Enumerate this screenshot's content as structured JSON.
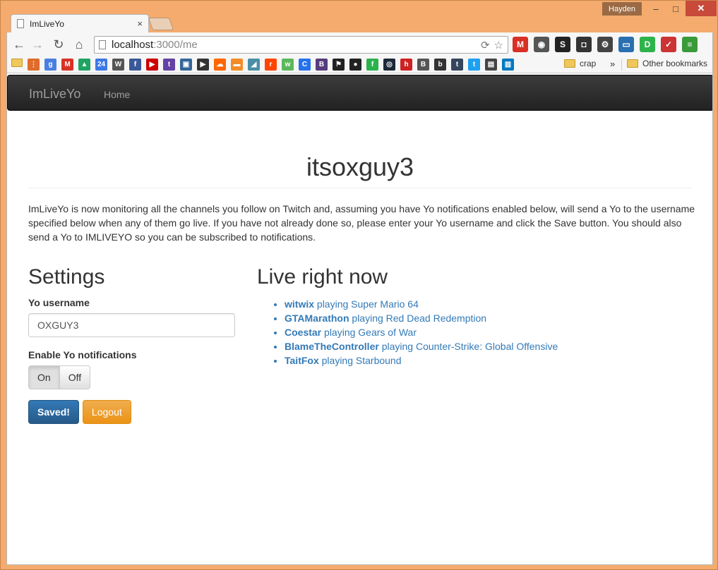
{
  "window": {
    "user": "Hayden",
    "minimize_glyph": "–",
    "maximize_glyph": "□",
    "close_glyph": "✕"
  },
  "tab": {
    "title": "ImLiveYo",
    "close_glyph": "×"
  },
  "toolbar": {
    "back_glyph": "←",
    "forward_glyph": "→",
    "reload_glyph": "↻",
    "home_glyph": "⌂",
    "url_host": "localhost",
    "url_path": ":3000/me",
    "search_glyph": "⟳",
    "star_glyph": "☆",
    "extensions": [
      {
        "icon": "gmail-icon",
        "label": "M",
        "color": "#d93025"
      },
      {
        "icon": "camera-icon",
        "label": "◉",
        "color": "#555555"
      },
      {
        "icon": "stylish-icon",
        "label": "S",
        "color": "#222222"
      },
      {
        "icon": "pinterest-icon",
        "label": "◘",
        "color": "#333333"
      },
      {
        "icon": "gear-icon",
        "label": "⚙",
        "color": "#444444"
      },
      {
        "icon": "screen-icon",
        "label": "▭",
        "color": "#2a6fb0"
      },
      {
        "icon": "disconnect-icon",
        "label": "D",
        "color": "#2db34a"
      },
      {
        "icon": "tracker-icon",
        "label": "✓",
        "color": "#c33"
      },
      {
        "icon": "menu-icon",
        "label": "≡",
        "color": "#3a9a3a"
      }
    ]
  },
  "bookmarks": {
    "icons": [
      {
        "icon": "apps-icon",
        "label": "⋮",
        "color": "#e06b2b"
      },
      {
        "icon": "google-icon",
        "label": "g",
        "color": "#4a7fe0"
      },
      {
        "icon": "gmail-bookmark-icon",
        "label": "M",
        "color": "#d93025"
      },
      {
        "icon": "drive-icon",
        "label": "▲",
        "color": "#1fa463"
      },
      {
        "icon": "calendar-icon",
        "label": "24",
        "color": "#3b78e7"
      },
      {
        "icon": "wikipedia-icon",
        "label": "W",
        "color": "#555555"
      },
      {
        "icon": "facebook-icon",
        "label": "f",
        "color": "#3b5998"
      },
      {
        "icon": "youtube-icon",
        "label": "▶",
        "color": "#cc0000"
      },
      {
        "icon": "twitch-icon",
        "label": "t",
        "color": "#6441a5"
      },
      {
        "icon": "tv-icon",
        "label": "▣",
        "color": "#336699"
      },
      {
        "icon": "play-icon",
        "label": "▶",
        "color": "#333333"
      },
      {
        "icon": "soundcloud-icon",
        "label": "☁",
        "color": "#ff6600"
      },
      {
        "icon": "audio-icon",
        "label": "▬",
        "color": "#f28c28"
      },
      {
        "icon": "paper-icon",
        "label": "◢",
        "color": "#4a8fa6"
      },
      {
        "icon": "reddit-icon",
        "label": "r",
        "color": "#ff4500"
      },
      {
        "icon": "w3-icon",
        "label": "w",
        "color": "#5cb85c"
      },
      {
        "icon": "moon-icon",
        "label": "C",
        "color": "#2672ec"
      },
      {
        "icon": "bootstrap-icon",
        "label": "B",
        "color": "#563d7c"
      },
      {
        "icon": "flag-icon",
        "label": "⚑",
        "color": "#222222"
      },
      {
        "icon": "github-icon",
        "label": "●",
        "color": "#222222"
      },
      {
        "icon": "feedly-icon",
        "label": "f",
        "color": "#2bb24c"
      },
      {
        "icon": "steam-icon",
        "label": "◎",
        "color": "#1b2838"
      },
      {
        "icon": "h-icon",
        "label": "h",
        "color": "#cc2222"
      },
      {
        "icon": "bitcoin-icon",
        "label": "B",
        "color": "#555555"
      },
      {
        "icon": "coin-icon",
        "label": "b",
        "color": "#333333"
      },
      {
        "icon": "tumblr-icon",
        "label": "t",
        "color": "#35465c"
      },
      {
        "icon": "twitter-icon",
        "label": "t",
        "color": "#1da1f2"
      },
      {
        "icon": "imdb-icon",
        "label": "▤",
        "color": "#444444"
      },
      {
        "icon": "trello-icon",
        "label": "▥",
        "color": "#0079bf"
      }
    ],
    "folder_label": "crap",
    "chevron": "»",
    "other_label": "Other bookmarks"
  },
  "navbar": {
    "brand": "ImLiveYo",
    "home": "Home"
  },
  "page": {
    "title": "itsoxguy3",
    "intro": "ImLiveYo is now monitoring all the channels you follow on Twitch and, assuming you have Yo notifications enabled below, will send a Yo to the username specified below when any of them go live. If you have not already done so, please enter your Yo username and click the Save button. You should also send a Yo to IMLIVEYO so you can be subscribed to notifications."
  },
  "settings": {
    "heading": "Settings",
    "yo_label": "Yo username",
    "yo_value": "OXGUY3",
    "notif_label": "Enable Yo notifications",
    "toggle_on": "On",
    "toggle_off": "Off",
    "save_label": "Saved!",
    "logout_label": "Logout"
  },
  "live": {
    "heading": "Live right now",
    "items": [
      {
        "channel": "witwix",
        "activity": " playing Super Mario 64"
      },
      {
        "channel": "GTAMarathon",
        "activity": " playing Red Dead Redemption"
      },
      {
        "channel": "Coestar",
        "activity": " playing Gears of War"
      },
      {
        "channel": "BlameTheController",
        "activity": " playing Counter-Strike: Global Offensive"
      },
      {
        "channel": "TaitFox",
        "activity": " playing Starbound"
      }
    ]
  }
}
